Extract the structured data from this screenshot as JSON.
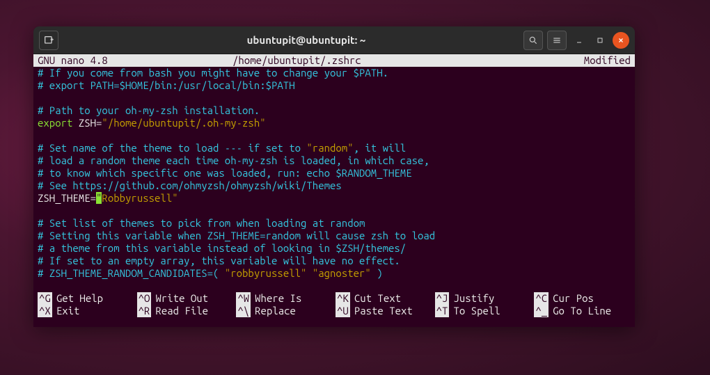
{
  "titlebar": {
    "title": "ubuntupit@ubuntupit: ~"
  },
  "nano": {
    "app": "  GNU nano 4.8",
    "filepath": "/home/ubuntupit/.zshrc",
    "status": "Modified"
  },
  "lines": {
    "l1": "# If you come from bash you might have to change your $PATH.",
    "l2": "# export PATH=$HOME/bin:/usr/local/bin:$PATH",
    "l3": "# Path to your oh-my-zsh installation.",
    "l4a": "export",
    "l4b": " ZSH",
    "l4c": "=",
    "l4d": "\"/home/ubuntupit/.oh-my-zsh\"",
    "l5a": "# Set name of the theme to load --- if set to ",
    "l5b": "\"random\"",
    "l5c": ", it will",
    "l6": "# load a random theme each time oh-my-zsh is loaded, in which case,",
    "l7": "# to know which specific one was loaded, run: echo $RANDOM_THEME",
    "l8": "# See https://github.com/ohmyzsh/ohmyzsh/wiki/Themes",
    "l9a": "ZSH_THEME",
    "l9b": "=",
    "l9c": "\"",
    "l9d": "Robbyrussell\"",
    "l10": "# Set list of themes to pick from when loading at random",
    "l11": "# Setting this variable when ZSH_THEME=random will cause zsh to load",
    "l12": "# a theme from this variable instead of looking in $ZSH/themes/",
    "l13": "# If set to an empty array, this variable will have no effect.",
    "l14a": "# ZSH_THEME_RANDOM_CANDIDATES=( ",
    "l14b": "\"robbyrussell\" \"agnoster\"",
    "l14c": " )"
  },
  "shortcuts": {
    "r1": [
      {
        "key": "^G",
        "label": "Get Help"
      },
      {
        "key": "^O",
        "label": "Write Out"
      },
      {
        "key": "^W",
        "label": "Where Is"
      },
      {
        "key": "^K",
        "label": "Cut Text"
      },
      {
        "key": "^J",
        "label": "Justify"
      },
      {
        "key": "^C",
        "label": "Cur Pos"
      }
    ],
    "r2": [
      {
        "key": "^X",
        "label": "Exit"
      },
      {
        "key": "^R",
        "label": "Read File"
      },
      {
        "key": "^\\",
        "label": "Replace"
      },
      {
        "key": "^U",
        "label": "Paste Text"
      },
      {
        "key": "^T",
        "label": "To Spell"
      },
      {
        "key": "^_",
        "label": "Go To Line"
      }
    ]
  }
}
